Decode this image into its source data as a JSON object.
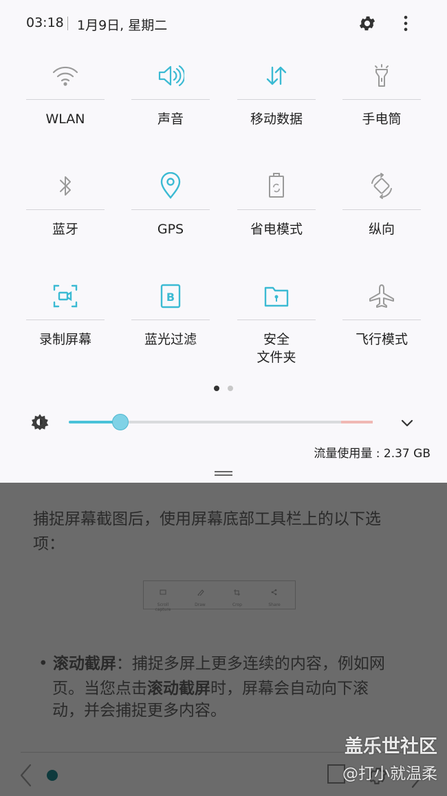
{
  "status": {
    "time": "03:18",
    "date": "1月9日, 星期二"
  },
  "tiles": [
    {
      "label": "WLAN",
      "icon": "wifi-icon",
      "active": false
    },
    {
      "label": "声音",
      "icon": "volume-icon",
      "active": true
    },
    {
      "label": "移动数据",
      "icon": "mobile-data-icon",
      "active": true
    },
    {
      "label": "手电筒",
      "icon": "flashlight-icon",
      "active": false
    },
    {
      "label": "蓝牙",
      "icon": "bluetooth-icon",
      "active": false
    },
    {
      "label": "GPS",
      "icon": "location-icon",
      "active": true
    },
    {
      "label": "省电模式",
      "icon": "battery-saver-icon",
      "active": false
    },
    {
      "label": "纵向",
      "icon": "rotation-icon",
      "active": false
    },
    {
      "label": "录制屏幕",
      "icon": "screen-record-icon",
      "active": true
    },
    {
      "label": "蓝光过滤",
      "icon": "blue-light-filter-icon",
      "active": true
    },
    {
      "label": "安全\n文件夹",
      "icon": "secure-folder-icon",
      "active": true
    },
    {
      "label": "飞行模式",
      "icon": "airplane-icon",
      "active": false
    }
  ],
  "pages": {
    "count": 2,
    "current": 1
  },
  "brightness": {
    "level": 0.17,
    "icon": "brightness-icon"
  },
  "data_usage": "流量使用量 : 2.37 GB",
  "background": {
    "paragraph1_line1": "捕捉屏幕截图后，使用屏幕底部工具栏上的以下选",
    "paragraph1_line2": "项：",
    "bullet": "•",
    "bullet_bold": "滚动截屏",
    "bullet_line1_rest": "：捕捉多屏上更多连续的内容，例如网",
    "bullet_line2_pre": "页。当您点击",
    "bullet_line2_bold": "滚动截屏",
    "bullet_line2_post": "时，屏幕会自动向下滚",
    "bullet_line3": "动，并会捕捉更多内容。",
    "toolbar_items": [
      "Scroll capture",
      "Draw",
      "Crop",
      "Share"
    ]
  },
  "watermark": {
    "line1": "盖乐世社区",
    "line2": "@打小就温柔"
  },
  "colors": {
    "accent": "#3bbad3",
    "inactive": "#9a9a9a",
    "panel": "#f9f8fb",
    "dim": "#6b6b6b"
  }
}
